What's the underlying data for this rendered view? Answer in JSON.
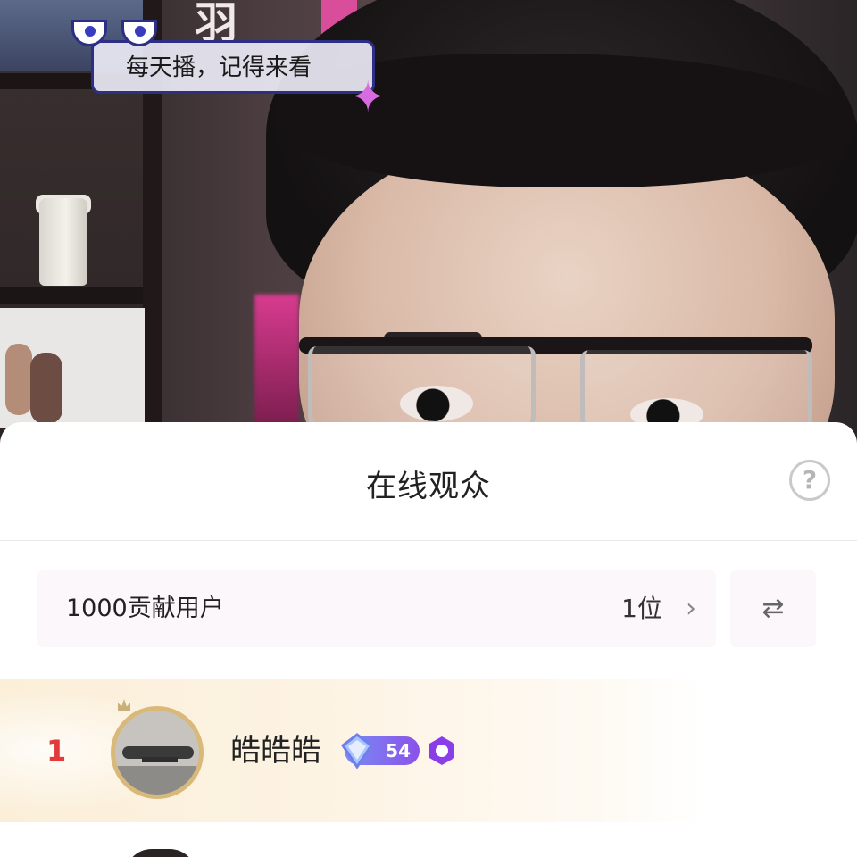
{
  "overlay": {
    "sticker_text": "每天播，记得来看"
  },
  "sheet": {
    "title": "在线观众",
    "help_icon": "question-circle-icon",
    "help_symbol": "?"
  },
  "contribution": {
    "label": "1000贡献用户",
    "count": "1位",
    "chevron": "›",
    "switch_icon": "⇄"
  },
  "viewers": [
    {
      "rank": "1",
      "name": "皓皓皓",
      "level": "54",
      "rank_color": "#e23a3a"
    }
  ],
  "colors": {
    "badge_gradient_start": "#7a8cf5",
    "badge_gradient_end": "#8a52e8",
    "row_highlight": "#fbefd9",
    "contribution_bg": "#fbf7fb"
  }
}
